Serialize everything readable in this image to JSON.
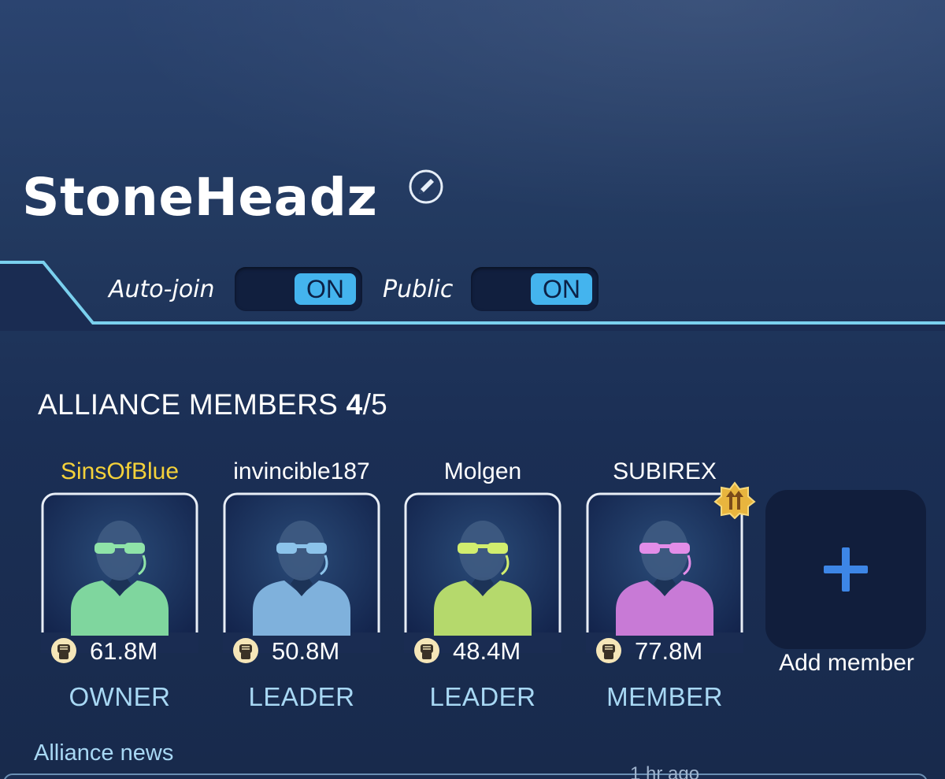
{
  "alliance": {
    "name": "StoneHeadz"
  },
  "settings": {
    "auto_join_label": "Auto-join",
    "auto_join_state": "ON",
    "public_label": "Public",
    "public_state": "ON"
  },
  "members_section": {
    "title": "ALLIANCE MEMBERS",
    "count_current": "4",
    "count_max": "/5"
  },
  "members": [
    {
      "name": "SinsOfBlue",
      "power": "61.8M",
      "role": "OWNER",
      "avatar_color": "#7fd69e",
      "glasses_color": "#8fe3a8"
    },
    {
      "name": "invincible187",
      "power": "50.8M",
      "role": "LEADER",
      "avatar_color": "#7fb1dc",
      "glasses_color": "#8cc3ea"
    },
    {
      "name": "Molgen",
      "power": "48.4M",
      "role": "LEADER",
      "avatar_color": "#b5d96c",
      "glasses_color": "#d2ee6e"
    },
    {
      "name": "SUBIREX",
      "power": "77.8M",
      "role": "MEMBER",
      "avatar_color": "#c87ad6",
      "glasses_color": "#e38de8"
    }
  ],
  "add_member": {
    "label": "Add member"
  },
  "news": {
    "label": "Alliance news",
    "timestamp": "1 hr ago"
  },
  "colors": {
    "owner_name": "#f4d13a",
    "role_text": "#a8d8f4",
    "toggle_on": "#44b4ee",
    "accent_line": "#7ad0ee",
    "plus": "#3d86e6"
  }
}
